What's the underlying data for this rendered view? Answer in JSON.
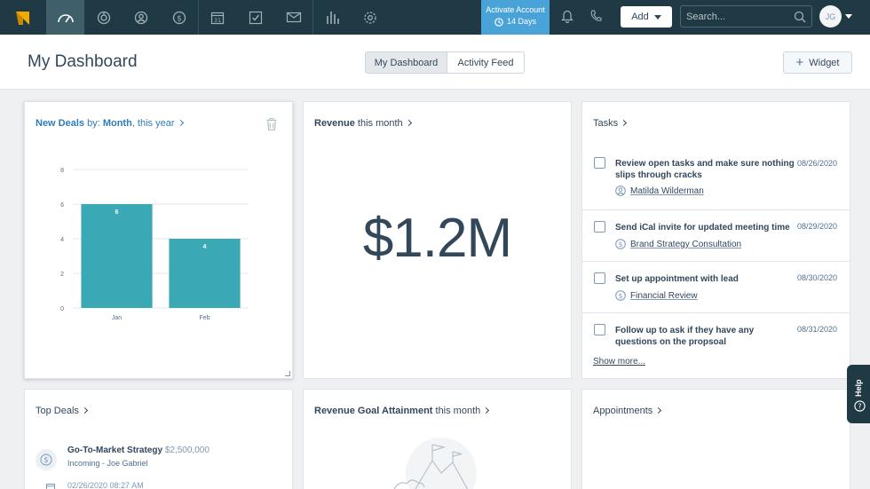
{
  "nav": {
    "icons": [
      "dashboard-icon",
      "activity-icon",
      "contacts-icon",
      "deals-icon",
      "calendar-icon",
      "tasks-icon",
      "inbox-icon",
      "reports-icon",
      "settings-icon"
    ],
    "calendar_day": "31",
    "activate": {
      "line1": "Activate Account",
      "line2": "14 Days"
    },
    "add_label": "Add",
    "search_placeholder": "Search...",
    "avatar_initials": "JG"
  },
  "header": {
    "title": "My Dashboard",
    "tabs": [
      {
        "label": "My Dashboard"
      },
      {
        "label": "Activity Feed"
      }
    ],
    "widget_label": "Widget"
  },
  "new_deals": {
    "title_a": "New Deals",
    "title_b": " by: ",
    "title_c": "Month",
    "title_d": ", this year"
  },
  "chart_data": {
    "type": "bar",
    "categories": [
      "Jan",
      "Feb"
    ],
    "values": [
      6,
      4
    ],
    "ylim": [
      0,
      8
    ],
    "yticks": [
      0,
      2,
      4,
      6,
      8
    ],
    "bar_color": "#3aa9b5",
    "data_labels": true,
    "grid": true
  },
  "revenue": {
    "title_a": "Revenue",
    "title_b": " this month",
    "value": "$1.2M"
  },
  "tasks": {
    "title": "Tasks",
    "items": [
      {
        "title": "Review open tasks and make sure nothing slips through cracks",
        "date": "08/26/2020",
        "assoc": "Matilda Wilderman",
        "assoc_icon": "person-icon"
      },
      {
        "title": "Send iCal invite for updated meeting time",
        "date": "08/29/2020",
        "assoc": "Brand Strategy Consultation",
        "assoc_icon": "dollar-icon"
      },
      {
        "title": "Set up appointment with lead",
        "date": "08/30/2020",
        "assoc": "Financial Review",
        "assoc_icon": "dollar-icon"
      },
      {
        "title": "Follow up to ask if they have any questions on the propsoal",
        "date": "08/31/2020"
      }
    ],
    "show_more": "Show more..."
  },
  "top_deals": {
    "title": "Top Deals",
    "deal_name": "Go-To-Market Strategy",
    "deal_amount": "$2,500,000",
    "deal_sub": "Incoming - Joe Gabriel",
    "deal_ts": "02/26/2020 08:27 AM"
  },
  "goal": {
    "title_a": "Revenue Goal Attainment",
    "title_b": " this month"
  },
  "appointments": {
    "title": "Appointments"
  },
  "help": {
    "label": "Help"
  },
  "colors": {
    "nav_bg": "#1f3a44",
    "accent": "#4aa3d8",
    "bar": "#3aa9b5",
    "link": "#2f7cba"
  }
}
